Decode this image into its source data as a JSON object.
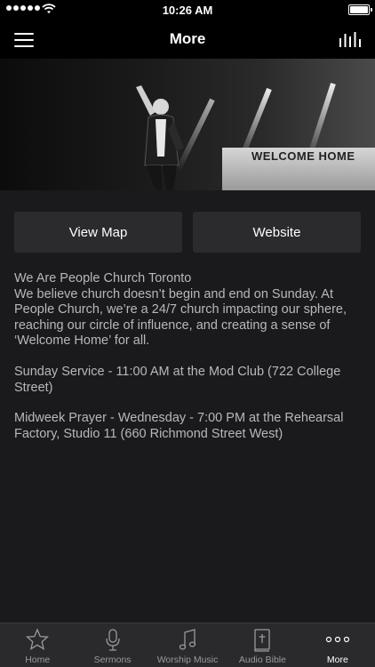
{
  "status_bar": {
    "time": "10:26 AM"
  },
  "nav": {
    "title": "More"
  },
  "hero": {
    "screen_text": "WELCOME HOME"
  },
  "buttons": {
    "view_map": "View Map",
    "website": "Website"
  },
  "content": {
    "paragraphs": [
      "We Are People Church Toronto\nWe believe church doesn’t begin and end on Sunday. At People Church, we’re a 24/7 church impacting our sphere, reaching our circle of influence, and creating a sense of ‘Welcome Home’ for all.",
      "Sunday Service - 11:00 AM at the Mod Club (722 College Street)",
      "Midweek Prayer - Wednesday - 7:00 PM at the Rehearsal Factory, Studio 11 (660 Richmond Street West)"
    ]
  },
  "tabs": [
    {
      "label": "Home",
      "icon": "star-icon",
      "active": false
    },
    {
      "label": "Sermons",
      "icon": "microphone-icon",
      "active": false
    },
    {
      "label": "Worship Music",
      "icon": "music-note-icon",
      "active": false
    },
    {
      "label": "Audio Bible",
      "icon": "bible-icon",
      "active": false
    },
    {
      "label": "More",
      "icon": "more-dots-icon",
      "active": true
    }
  ]
}
